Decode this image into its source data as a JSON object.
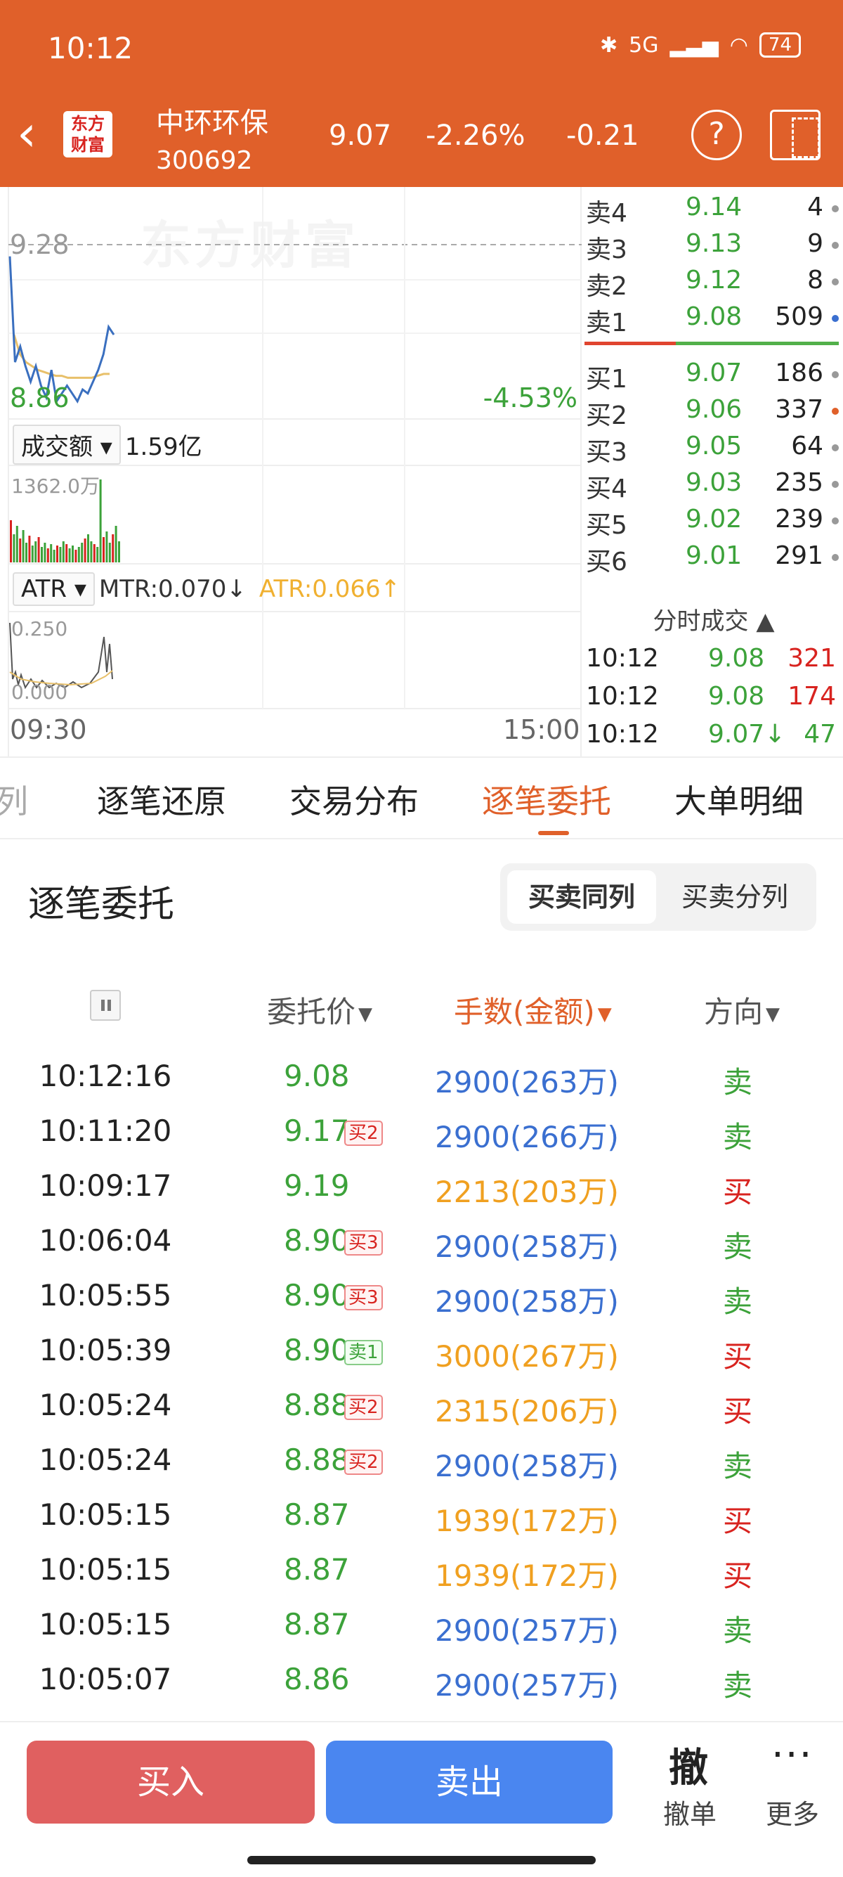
{
  "status": {
    "time": "10:12",
    "network": "5G",
    "battery": "74"
  },
  "header": {
    "logo": "东方财富",
    "name": "中环环保",
    "code": "300692",
    "price": "9.07",
    "change_pct": "-2.26%",
    "change": "-0.21"
  },
  "chart": {
    "watermark": "东方财富",
    "y_top": "9.28",
    "y_bottom": "8.86",
    "pct_bottom": "-4.53%",
    "volume_label": "成交额",
    "volume_value": "1.59亿",
    "volume_max": "1362.0万",
    "indicator": "ATR",
    "mtr": "MTR:0.070↓",
    "atr": "ATR:0.066↑",
    "ind_top": "0.250",
    "ind_bottom": "0.000",
    "time_start": "09:30",
    "time_end": "15:00",
    "price_line": [
      9.25,
      8.98,
      9.02,
      8.97,
      8.93,
      8.97,
      8.92,
      8.89,
      8.96,
      8.88,
      8.9,
      8.92,
      8.9,
      8.88,
      8.91,
      8.9,
      8.93,
      8.96,
      9.0,
      9.07,
      9.05
    ],
    "avg_line": [
      9.05,
      9.0,
      8.98,
      8.97,
      8.96,
      8.955,
      8.95,
      8.945,
      8.945,
      8.94,
      8.94,
      8.94,
      8.94,
      8.94,
      8.945,
      8.95,
      8.95
    ]
  },
  "order_book": {
    "asks": [
      {
        "label": "卖4",
        "price": "9.14",
        "vol": "4"
      },
      {
        "label": "卖3",
        "price": "9.13",
        "vol": "9"
      },
      {
        "label": "卖2",
        "price": "9.12",
        "vol": "8"
      },
      {
        "label": "卖1",
        "price": "9.08",
        "vol": "509"
      }
    ],
    "bids": [
      {
        "label": "买1",
        "price": "9.07",
        "vol": "186"
      },
      {
        "label": "买2",
        "price": "9.06",
        "vol": "337"
      },
      {
        "label": "买3",
        "price": "9.05",
        "vol": "64"
      },
      {
        "label": "买4",
        "price": "9.03",
        "vol": "235"
      },
      {
        "label": "买5",
        "price": "9.02",
        "vol": "239"
      },
      {
        "label": "买6",
        "price": "9.01",
        "vol": "291"
      }
    ],
    "tick_title": "分时成交",
    "trades": [
      {
        "time": "10:12",
        "price": "9.08",
        "vol": "321",
        "color": "#d8231f"
      },
      {
        "time": "10:12",
        "price": "9.08",
        "vol": "174",
        "color": "#d8231f"
      },
      {
        "time": "10:12",
        "price": "9.07↓",
        "vol": "47",
        "color": "#3ca23a"
      }
    ]
  },
  "tabs": [
    {
      "label": "列"
    },
    {
      "label": "逐笔还原"
    },
    {
      "label": "交易分布"
    },
    {
      "label": "逐笔委托"
    },
    {
      "label": "大单明细"
    }
  ],
  "section": {
    "title": "逐笔委托",
    "seg_on": "买卖同列",
    "seg_off": "买卖分列",
    "col_price": "委托价",
    "col_amount": "手数(金额)",
    "col_dir": "方向"
  },
  "orders": [
    {
      "time": "10:12:16",
      "price": "9.08",
      "tag": "",
      "amount": "2900(263万)",
      "dir": "卖"
    },
    {
      "time": "10:11:20",
      "price": "9.17",
      "tag": "买2",
      "amount": "2900(266万)",
      "dir": "卖"
    },
    {
      "time": "10:09:17",
      "price": "9.19",
      "tag": "",
      "amount": "2213(203万)",
      "dir": "买"
    },
    {
      "time": "10:06:04",
      "price": "8.90",
      "tag": "买3",
      "amount": "2900(258万)",
      "dir": "卖"
    },
    {
      "time": "10:05:55",
      "price": "8.90",
      "tag": "买3",
      "amount": "2900(258万)",
      "dir": "卖"
    },
    {
      "time": "10:05:39",
      "price": "8.90",
      "tag": "卖1",
      "amount": "3000(267万)",
      "dir": "买"
    },
    {
      "time": "10:05:24",
      "price": "8.88",
      "tag": "买2",
      "amount": "2315(206万)",
      "dir": "买"
    },
    {
      "time": "10:05:24",
      "price": "8.88",
      "tag": "买2",
      "amount": "2900(258万)",
      "dir": "卖"
    },
    {
      "time": "10:05:15",
      "price": "8.87",
      "tag": "",
      "amount": "1939(172万)",
      "dir": "买"
    },
    {
      "time": "10:05:15",
      "price": "8.87",
      "tag": "",
      "amount": "1939(172万)",
      "dir": "买"
    },
    {
      "time": "10:05:15",
      "price": "8.87",
      "tag": "",
      "amount": "2900(257万)",
      "dir": "卖"
    },
    {
      "time": "10:05:07",
      "price": "8.86",
      "tag": "",
      "amount": "2900(257万)",
      "dir": "卖"
    }
  ],
  "bottom": {
    "buy": "买入",
    "sell": "卖出",
    "cancel_icon": "撤",
    "cancel": "撤单",
    "more_icon": "···",
    "more": "更多"
  },
  "colors": {
    "brand": "#e0602a",
    "up": "#d8231f",
    "down": "#3ca23a",
    "blue": "#3a6fd0",
    "orange": "#f0a020"
  }
}
